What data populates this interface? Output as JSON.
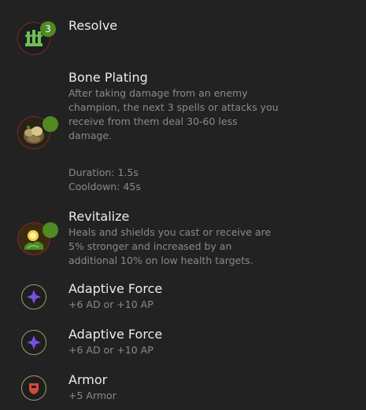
{
  "tree": {
    "name": "Resolve",
    "count": "3",
    "icon": "resolve-tree-icon"
  },
  "runes": [
    {
      "name": "Bone Plating",
      "icon": "bone-plating-icon",
      "description": [
        "After taking damage from an enemy",
        "champion, the next 3 spells or attacks you",
        "receive from them deal 30-60 less",
        "damage."
      ],
      "duration": "Duration: 1.5s",
      "cooldown": "Cooldown: 45s"
    },
    {
      "name": "Revitalize",
      "icon": "revitalize-icon",
      "description": [
        "Heals and shields you cast or receive are",
        "5% stronger and increased by an",
        "additional 10% on low health targets."
      ]
    }
  ],
  "shards": [
    {
      "name": "Adaptive Force",
      "value": "+6 AD or +10 AP",
      "icon": "adaptive-force-icon"
    },
    {
      "name": "Adaptive Force",
      "value": "+6 AD or +10 AP",
      "icon": "adaptive-force-icon"
    },
    {
      "name": "Armor",
      "value": "+5 Armor",
      "icon": "armor-shield-icon"
    }
  ],
  "colors": {
    "background": "#222222",
    "title": "#ececec",
    "description": "#8a8a8a",
    "badge_green": "#4f8a22",
    "icon_ring_red": "#7a2a26",
    "shard_ring_gold": "#a59a66",
    "adaptive_purple": "#7b4fe0",
    "armor_red": "#d44a3a"
  }
}
